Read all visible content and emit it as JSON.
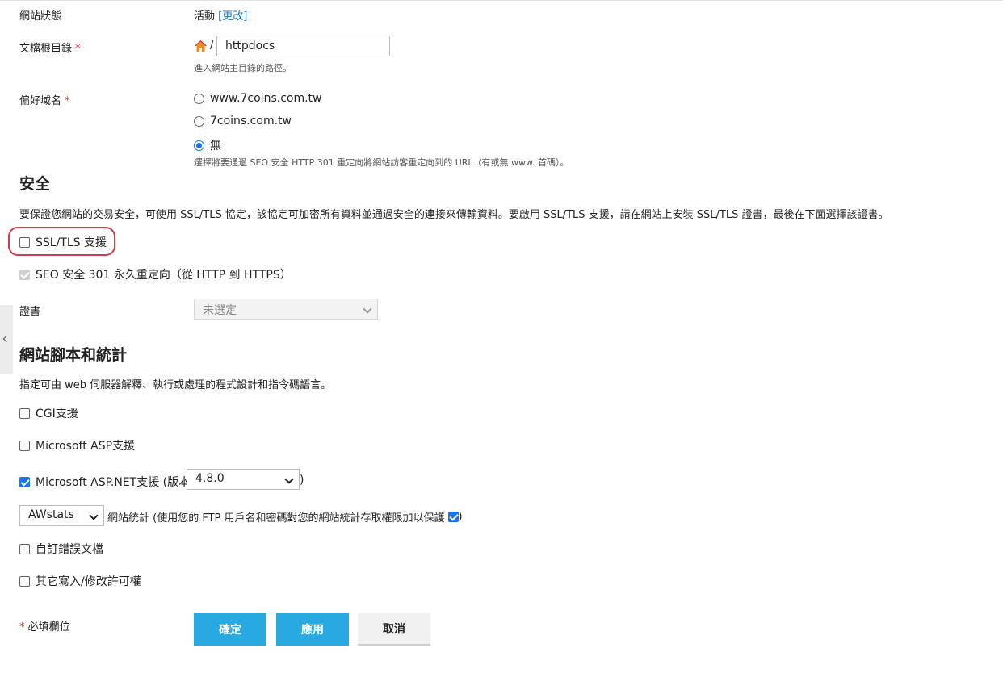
{
  "site_status": {
    "label": "網站狀態",
    "value": "活動",
    "change_link": "[更改]"
  },
  "doc_root": {
    "label": "文檔根目錄",
    "required_mark": "*",
    "separator": "/",
    "value": "httpdocs",
    "hint": "進入網站主目錄的路徑。"
  },
  "preferred_domain": {
    "label": "偏好域名",
    "required_mark": "*",
    "options": [
      {
        "label": "www.7coins.com.tw",
        "selected": false
      },
      {
        "label": "7coins.com.tw",
        "selected": false
      },
      {
        "label": "無",
        "selected": true
      }
    ],
    "hint": "選擇將要通過 SEO 安全 HTTP 301 重定向將網站訪客重定向到的 URL（有或無 www. 首碼）。"
  },
  "security": {
    "heading": "安全",
    "description": "要保證您網站的交易安全，可使用 SSL/TLS 協定，該協定可加密所有資料並通過安全的連接來傳輸資料。要啟用 SSL/TLS 支援，請在網站上安裝 SSL/TLS 證書，最後在下面選擇該證書。",
    "ssl_label": "SSL/TLS 支援",
    "ssl_checked": false,
    "redirect_label": "SEO 安全 301 永久重定向（從 HTTP 到 HTTPS）",
    "redirect_checked": true,
    "cert_label": "證書",
    "cert_value": "未選定"
  },
  "scripting": {
    "heading": "網站腳本和統計",
    "description": "指定可由 web 伺服器解釋、執行或處理的程式設計和指令碼語言。",
    "cgi_label": "CGI支援",
    "cgi_checked": false,
    "asp_label": "Microsoft ASP支援",
    "asp_checked": false,
    "aspnet_label": "Microsoft ASP.NET支援 (版本",
    "aspnet_checked": true,
    "aspnet_version": "4.8.0",
    "aspnet_close": ")",
    "stats_engine": "AWstats",
    "stats_label": "網站統計 (使用您的 FTP 用戶名和密碼對您的網站統計存取權限加以保護",
    "stats_protect_checked": true,
    "stats_close": ")",
    "custom_errors_label": "自訂錯誤文檔",
    "custom_errors_checked": false,
    "write_perm_label": "其它寫入/修改許可權",
    "write_perm_checked": false
  },
  "footer": {
    "required_mark": "*",
    "required_note": "必填欄位",
    "ok_label": "確定",
    "apply_label": "應用",
    "cancel_label": "取消"
  },
  "colors": {
    "primary_button": "#28a9e0",
    "link": "#1c73b6",
    "required": "#d02b2b",
    "highlight": "#d23a47",
    "checkbox": "#1a73e8"
  }
}
